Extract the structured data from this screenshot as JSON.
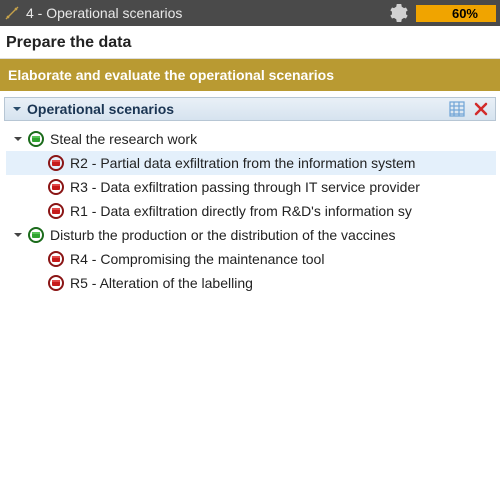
{
  "topbar": {
    "title": "4 - Operational scenarios",
    "progress": "60%"
  },
  "subheader": "Prepare the data",
  "banner": "Elaborate and evaluate the operational scenarios",
  "panel": {
    "title": "Operational scenarios"
  },
  "tree": {
    "nodes": [
      {
        "label": "Steal the research work",
        "icon": "folder",
        "expanded": true,
        "children": [
          {
            "label": "R2 - Partial data exfiltration from the information system",
            "icon": "risk",
            "selected": true
          },
          {
            "label": "R3 - Data exfiltration passing through IT service provider",
            "icon": "risk"
          },
          {
            "label": "R1 - Data exfiltration directly from R&D's information sy",
            "icon": "risk"
          }
        ]
      },
      {
        "label": "Disturb the production or the distribution of the vaccines",
        "icon": "folder",
        "expanded": true,
        "children": [
          {
            "label": "R4 - Compromising the maintenance tool",
            "icon": "risk"
          },
          {
            "label": "R5 - Alteration of the labelling",
            "icon": "risk"
          }
        ]
      }
    ]
  }
}
